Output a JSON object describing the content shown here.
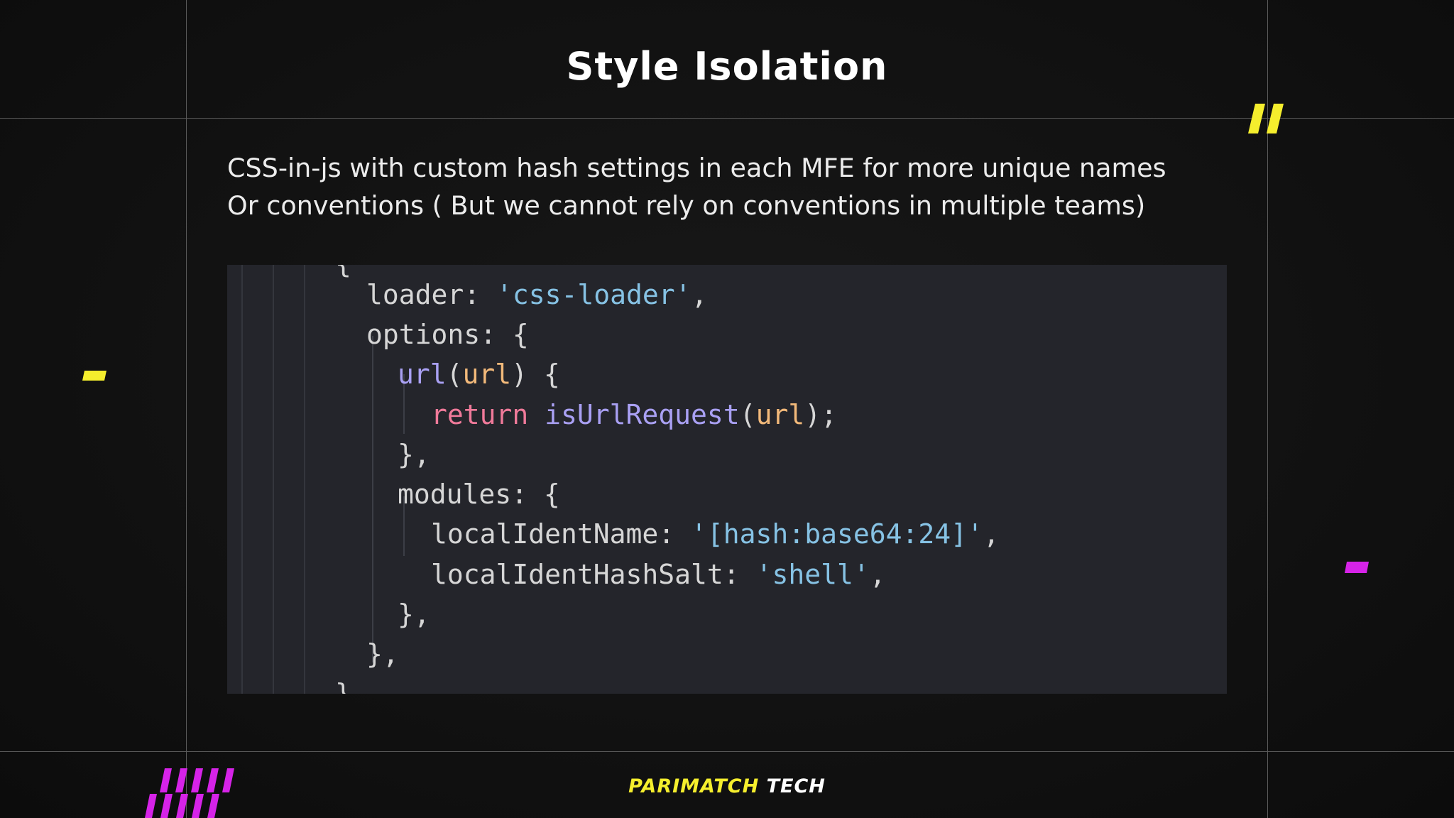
{
  "slide": {
    "title": "Style Isolation",
    "description_lines": [
      "CSS-in-js with custom hash settings in each MFE for more unique names",
      "Or conventions ( But we cannot rely on conventions in multiple teams)"
    ]
  },
  "code": {
    "lines": [
      [
        {
          "t": "{",
          "c": "punct"
        }
      ],
      [
        {
          "t": "loader: ",
          "c": "prop"
        },
        {
          "t": "'css-loader'",
          "c": "str"
        },
        {
          "t": ",",
          "c": "punct"
        }
      ],
      [
        {
          "t": "options: {",
          "c": "prop"
        }
      ],
      [
        {
          "t": "url",
          "c": "fn"
        },
        {
          "t": "(",
          "c": "punct"
        },
        {
          "t": "url",
          "c": "param"
        },
        {
          "t": ") {",
          "c": "punct"
        }
      ],
      [
        {
          "t": "return ",
          "c": "k"
        },
        {
          "t": "isUrlRequest",
          "c": "fn"
        },
        {
          "t": "(",
          "c": "punct"
        },
        {
          "t": "url",
          "c": "param"
        },
        {
          "t": ");",
          "c": "punct"
        }
      ],
      [
        {
          "t": "},",
          "c": "punct"
        }
      ],
      [
        {
          "t": "modules: {",
          "c": "prop"
        }
      ],
      [
        {
          "t": "localIdentName: ",
          "c": "prop"
        },
        {
          "t": "'[hash:base64:24]'",
          "c": "str"
        },
        {
          "t": ",",
          "c": "punct"
        }
      ],
      [
        {
          "t": "localIdentHashSalt: ",
          "c": "prop"
        },
        {
          "t": "'shell'",
          "c": "str"
        },
        {
          "t": ",",
          "c": "punct"
        }
      ],
      [
        {
          "t": "},",
          "c": "punct"
        }
      ],
      [
        {
          "t": "},",
          "c": "punct"
        }
      ],
      [
        {
          "t": "}",
          "c": "punct"
        }
      ]
    ],
    "indent_levels": [
      3,
      4,
      4,
      5,
      6,
      5,
      5,
      6,
      6,
      5,
      4,
      3
    ]
  },
  "branding": {
    "logo_part_1": "PARIMATCH",
    "logo_part_2": "TECH",
    "colors": {
      "accent_yellow": "#f5ee2d",
      "accent_magenta": "#d623e8",
      "background": "#111111",
      "code_background": "#24252b"
    }
  }
}
